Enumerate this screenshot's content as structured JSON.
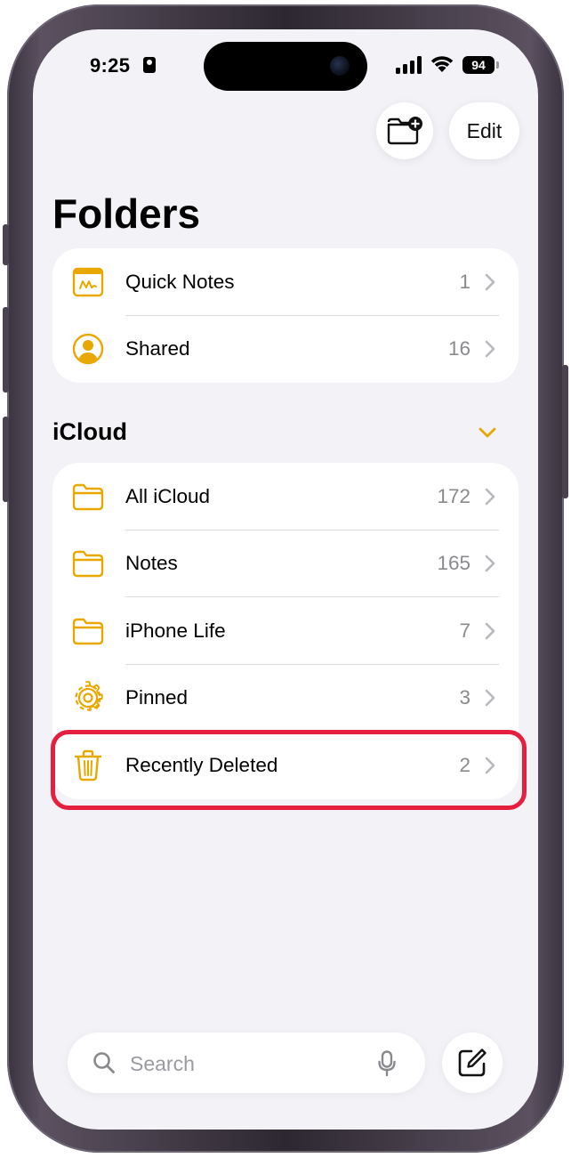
{
  "status_bar": {
    "time": "9:25",
    "battery": "94"
  },
  "toolbar": {
    "new_folder_icon": "folder-badge-plus-icon",
    "edit_label": "Edit"
  },
  "page_title": "Folders",
  "top_items": [
    {
      "label": "Quick Notes",
      "count": "1",
      "icon": "quick-note-icon"
    },
    {
      "label": "Shared",
      "count": "16",
      "icon": "person-circle-icon"
    }
  ],
  "icloud": {
    "header": "iCloud",
    "items": [
      {
        "label": "All iCloud",
        "count": "172",
        "icon": "folder-icon"
      },
      {
        "label": "Notes",
        "count": "165",
        "icon": "folder-icon"
      },
      {
        "label": "iPhone Life",
        "count": "7",
        "icon": "folder-icon"
      },
      {
        "label": "Pinned",
        "count": "3",
        "icon": "gear-icon"
      },
      {
        "label": "Recently Deleted",
        "count": "2",
        "icon": "trash-icon"
      }
    ]
  },
  "search": {
    "placeholder": "Search"
  },
  "colors": {
    "accent": "#E8A800",
    "highlight": "#E5203F",
    "background": "#F2F2F7"
  }
}
